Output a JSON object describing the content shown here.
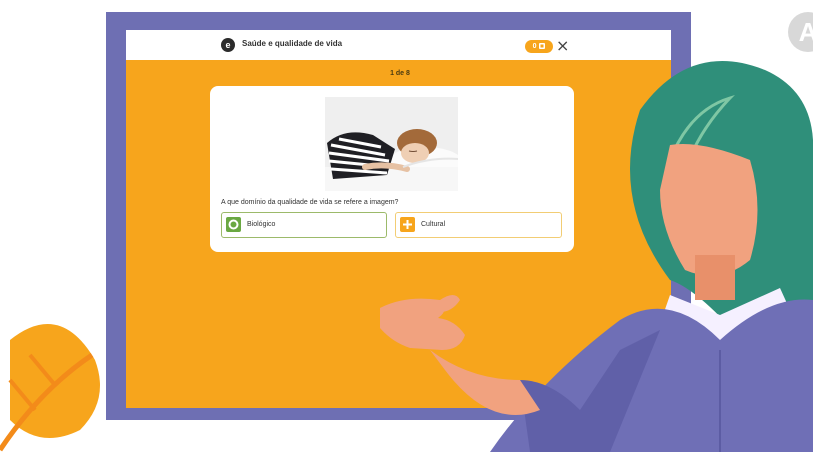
{
  "header": {
    "logo_letter": "e",
    "title": "Saúde e qualidade de vida",
    "score": "0",
    "close_symbol": "×"
  },
  "progress": "1 de 8",
  "question": {
    "text": "A que domínio da qualidade de vida se refere a imagem?",
    "image": "woman-sleeping-photo"
  },
  "answers": [
    {
      "label": "Biológico",
      "icon": "circle-icon",
      "color": "#6aa842"
    },
    {
      "label": "Cultural",
      "icon": "plus-icon",
      "color": "#f7a51c"
    }
  ],
  "overlay": {
    "avatar_letter": "A"
  },
  "colors": {
    "frame": "#6e6fb3",
    "slide": "#f7a51c",
    "presenter_hair": "#2f8f7a",
    "presenter_sweater": "#6f6fb6"
  }
}
